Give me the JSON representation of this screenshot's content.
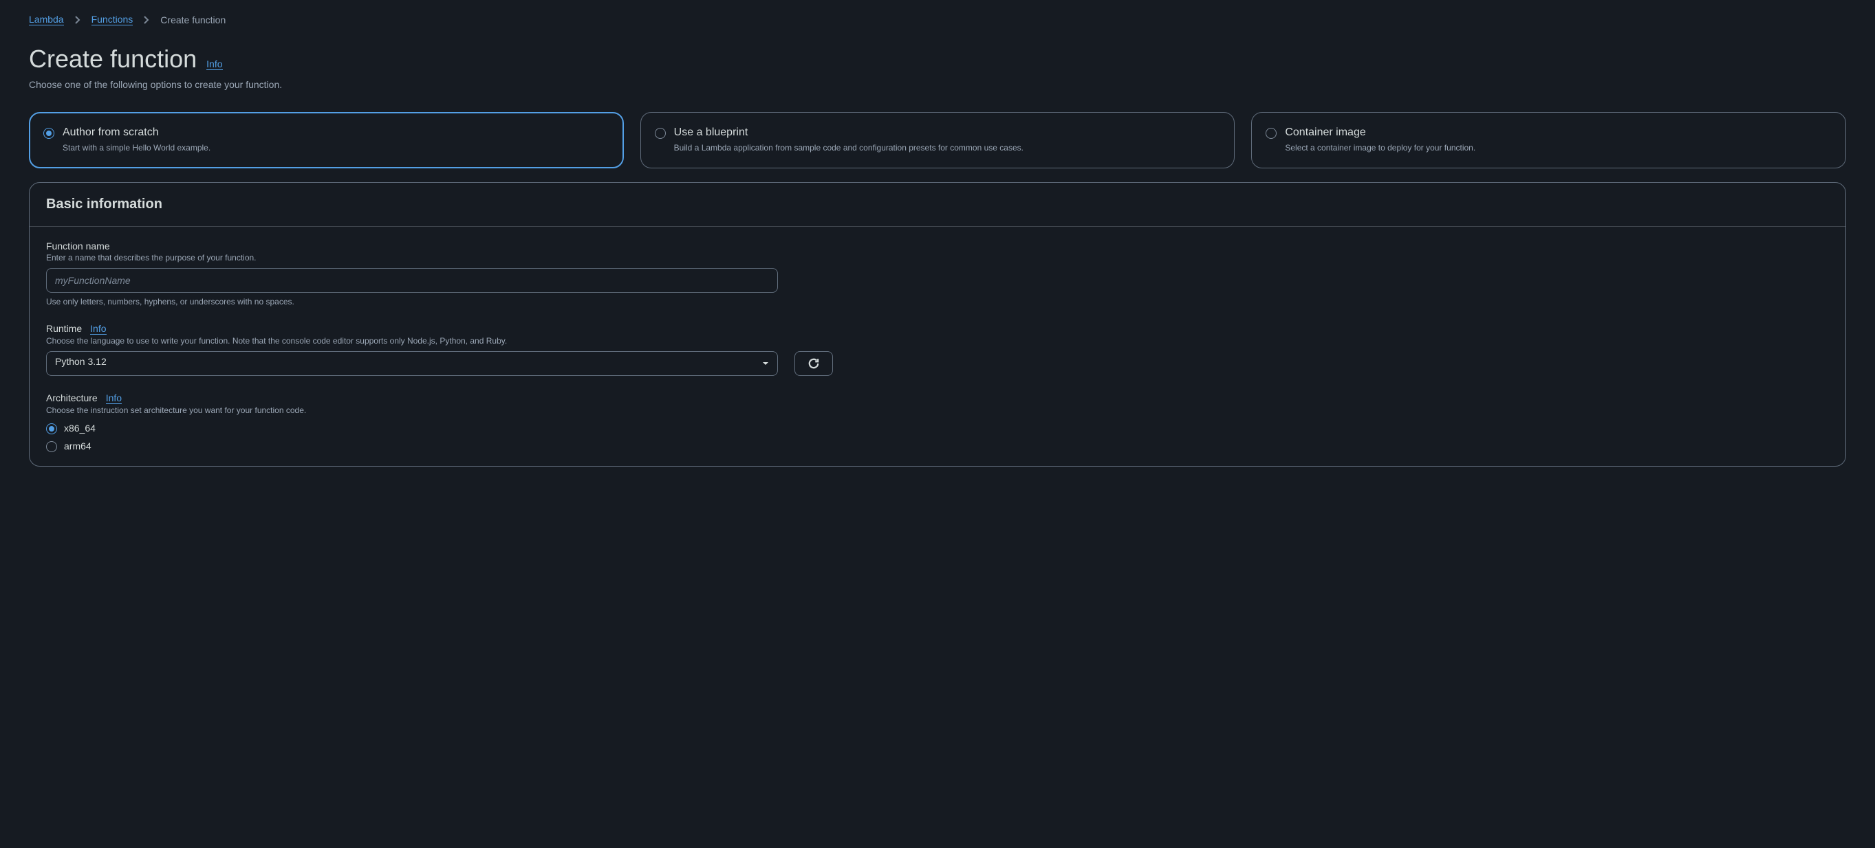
{
  "breadcrumb": {
    "items": [
      {
        "label": "Lambda",
        "link": true
      },
      {
        "label": "Functions",
        "link": true
      },
      {
        "label": "Create function",
        "link": false
      }
    ]
  },
  "header": {
    "title": "Create function",
    "info_label": "Info",
    "subtitle": "Choose one of the following options to create your function."
  },
  "options": [
    {
      "title": "Author from scratch",
      "desc": "Start with a simple Hello World example.",
      "selected": true
    },
    {
      "title": "Use a blueprint",
      "desc": "Build a Lambda application from sample code and configuration presets for common use cases.",
      "selected": false
    },
    {
      "title": "Container image",
      "desc": "Select a container image to deploy for your function.",
      "selected": false
    }
  ],
  "panel": {
    "title": "Basic information"
  },
  "form": {
    "function_name": {
      "label": "Function name",
      "hint": "Enter a name that describes the purpose of your function.",
      "placeholder": "myFunctionName",
      "value": "",
      "help": "Use only letters, numbers, hyphens, or underscores with no spaces."
    },
    "runtime": {
      "label": "Runtime",
      "info_label": "Info",
      "hint": "Choose the language to use to write your function. Note that the console code editor supports only Node.js, Python, and Ruby.",
      "value": "Python 3.12"
    },
    "architecture": {
      "label": "Architecture",
      "info_label": "Info",
      "hint": "Choose the instruction set architecture you want for your function code.",
      "options": [
        {
          "label": "x86_64",
          "selected": true
        },
        {
          "label": "arm64",
          "selected": false
        }
      ]
    }
  }
}
